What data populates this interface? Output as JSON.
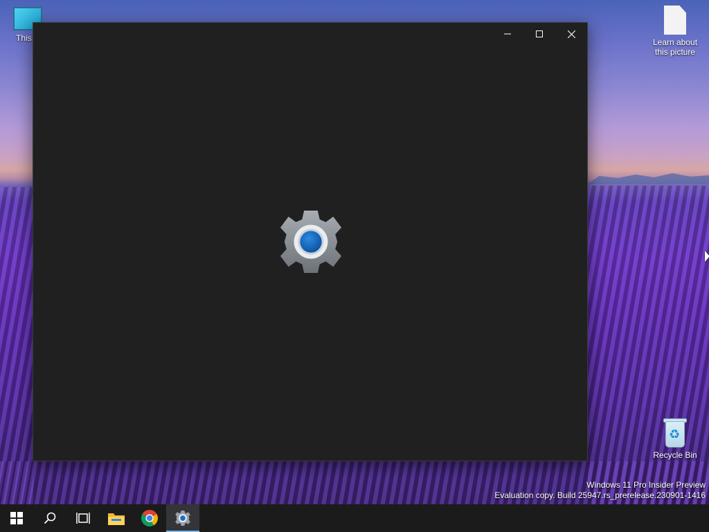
{
  "desktop": {
    "icons": [
      {
        "label": "This PC",
        "visible_label": "This P",
        "icon": "computer-icon"
      },
      {
        "label": "Learn about this picture",
        "line1": "Learn about",
        "line2": "this picture",
        "icon": "document-icon"
      },
      {
        "label": "Recycle Bin",
        "icon": "recycle-bin-icon"
      }
    ],
    "watermark": {
      "line1": "Windows 11 Pro Insider Preview",
      "line2": "Evaluation copy. Build 25947.rs_prerelease.230901-1416"
    }
  },
  "window": {
    "app": "Settings",
    "splash_icon": "settings-gear-icon",
    "background_color": "#202020",
    "controls": {
      "minimize_icon": "minimize-icon",
      "maximize_icon": "maximize-icon",
      "close_icon": "close-icon"
    }
  },
  "taskbar": {
    "items": [
      {
        "name": "start",
        "icon": "windows-logo-icon"
      },
      {
        "name": "search",
        "icon": "search-icon"
      },
      {
        "name": "task-view",
        "icon": "task-view-icon"
      },
      {
        "name": "file-explorer",
        "icon": "folder-icon"
      },
      {
        "name": "chrome",
        "icon": "chrome-icon"
      },
      {
        "name": "settings",
        "icon": "settings-gear-icon",
        "active": true
      }
    ],
    "accent_color": "#76b9ed"
  }
}
